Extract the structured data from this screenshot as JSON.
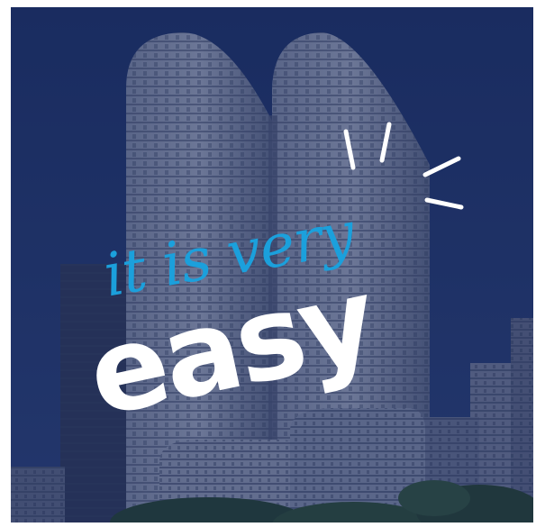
{
  "headline": {
    "script_line": "it is very",
    "bold_word": "easy"
  },
  "colors": {
    "background_blue": "#1f3468",
    "script_blue": "#1ba0dc",
    "bold_white": "#ffffff"
  },
  "icons": {
    "burst": "sparkle-burst-icon"
  }
}
